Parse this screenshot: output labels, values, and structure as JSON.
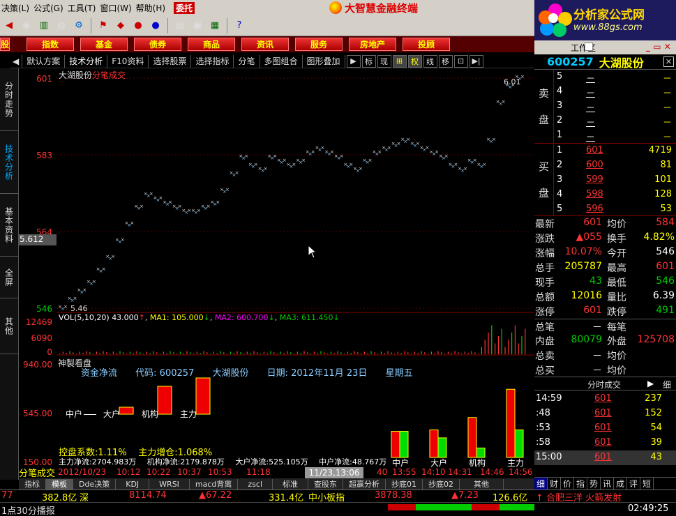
{
  "menu": {
    "items": [
      "决策(L)",
      "公式(G)",
      "工具(T)",
      "窗口(W)",
      "帮助(H)"
    ],
    "wt": "委托"
  },
  "brand": {
    "title": "大智慧金融终端",
    "ad_title": "分析家公式网",
    "ad_url": "www.88gs.com"
  },
  "nav": {
    "items": [
      "股",
      "指数",
      "基金",
      "债券",
      "商品",
      "资讯",
      "服务",
      "房地产",
      "投顾"
    ]
  },
  "funcbar": {
    "items": [
      "默认方案",
      "技术分析",
      "F10资料",
      "选择股票",
      "选择指标",
      "分笔",
      "多图组合",
      "图形叠加"
    ],
    "icons": [
      "标",
      "现",
      "⊞",
      "权",
      "线",
      "移"
    ]
  },
  "lefttabs": [
    "分时走势",
    "技术分析",
    "基本资料",
    "全屏",
    "其他"
  ],
  "chart": {
    "title": "大湖股份",
    "title_tag": "分笔成交",
    "ylabels": [
      "601",
      "583",
      "564",
      "546"
    ],
    "cursor_price": "5.612",
    "high_label": "6.01",
    "low_label": "5.46",
    "vol_legend": {
      "base": "VOL(5,10,20)",
      "v": "43.000",
      "ma1": "MA1: 105.000",
      "ma2": "MA2: 600.700",
      "ma3": "MA3: 611.450"
    },
    "vol_ylabels": [
      "12469",
      "6090",
      "0"
    ],
    "flow_ylabels": [
      "940.00",
      "545.00",
      "150.00"
    ]
  },
  "chart_data": {
    "type": "scatter",
    "title": "大湖股份 分笔成交",
    "x": [
      0,
      10,
      20,
      30,
      40,
      50,
      60,
      70,
      80,
      90,
      100,
      110,
      120,
      130,
      140,
      150,
      160,
      170,
      180,
      190,
      200,
      210,
      220,
      230,
      240,
      250,
      260,
      270,
      280,
      290,
      300,
      310,
      320,
      330,
      340,
      350,
      360,
      370,
      380,
      390,
      400,
      410,
      420,
      430,
      440,
      450,
      460,
      470,
      480,
      490,
      500,
      510,
      520,
      530,
      540,
      550,
      560,
      570,
      580,
      590,
      600,
      610,
      620,
      630,
      640,
      650,
      660,
      670,
      680
    ],
    "values": [
      5.46,
      5.48,
      5.5,
      5.52,
      5.55,
      5.58,
      5.62,
      5.66,
      5.7,
      5.73,
      5.72,
      5.71,
      5.7,
      5.69,
      5.69,
      5.7,
      5.71,
      5.74,
      5.78,
      5.82,
      5.8,
      5.79,
      5.82,
      5.81,
      5.8,
      5.81,
      5.83,
      5.84,
      5.83,
      5.82,
      5.8,
      5.79,
      5.81,
      5.83,
      5.84,
      5.85,
      5.86,
      5.85,
      5.84,
      5.83,
      5.82,
      5.8,
      5.79,
      5.81,
      5.8,
      5.86,
      5.95,
      5.99,
      6.01
    ],
    "ylim": [
      5.46,
      6.01
    ],
    "volume_ylim": [
      0,
      12469
    ]
  },
  "flow": {
    "head": "神製看盘",
    "label": "资金净流",
    "code": "代码: 600257",
    "name": "大湖股份",
    "date": "日期: 2012年11月 23日",
    "weekday": "星期五",
    "legend": [
      "中户",
      "大户",
      "机构",
      "主力"
    ],
    "kongpan": "控盘系数:1.11%",
    "zengcang": "主力增仓:1.068%",
    "vals": [
      "主力净流:2704.983万",
      "机构净流:2179.878万",
      "大户净流:525.105万",
      "中户净流:48.767万"
    ],
    "bars": [
      {
        "name": "中户",
        "a": 0.36,
        "b": 0.36
      },
      {
        "name": "大户",
        "a": 0.38,
        "b": 0.27
      },
      {
        "name": "机构",
        "a": 0.55,
        "b": 0.13
      },
      {
        "name": "主力",
        "a": 0.94,
        "b": 0.38
      }
    ]
  },
  "timeaxis": {
    "labels": [
      "2012/10/23",
      "10:12",
      "10:22",
      "10:37",
      "10:53",
      "11:18",
      "40",
      "13:55",
      "14:10",
      "14:31",
      "14:46",
      "14:56"
    ],
    "cursor": "11/23,13:06",
    "fbcs": "分笔成交"
  },
  "bottomtabs": [
    "指标",
    "模板",
    "Dde决策",
    "KDJ",
    "WRSI",
    "macd背离",
    "zscl",
    "标准",
    "查股东",
    "超赢分析",
    "抄底01",
    "抄底02",
    "其他"
  ],
  "status": {
    "a": "77",
    "b": "382.8亿",
    "c": "深",
    "d": "8114.74",
    "e": "▲67.22",
    "f": "331.4亿",
    "g": "中小板指",
    "h": "3878.38",
    "i": "▲7.23",
    "j": "126.6亿",
    "k": "↑ 合肥三洋 火箭发射",
    "l": "1点30分播报",
    "time": "02:49:25"
  },
  "rp": {
    "header": "工作区",
    "code": "600257",
    "name": "大湖股份",
    "sell_label": [
      "卖",
      "盘"
    ],
    "buy_label": [
      "买",
      "盘"
    ],
    "sells": [
      {
        "n": "5",
        "p": "－",
        "v": "－"
      },
      {
        "n": "4",
        "p": "－",
        "v": "－"
      },
      {
        "n": "3",
        "p": "－",
        "v": "－"
      },
      {
        "n": "2",
        "p": "－",
        "v": "－"
      },
      {
        "n": "1",
        "p": "－",
        "v": "－"
      }
    ],
    "buys": [
      {
        "n": "1",
        "p": "601",
        "v": "4719"
      },
      {
        "n": "2",
        "p": "600",
        "v": "81"
      },
      {
        "n": "3",
        "p": "599",
        "v": "101"
      },
      {
        "n": "4",
        "p": "598",
        "v": "128"
      },
      {
        "n": "5",
        "p": "596",
        "v": "53"
      }
    ],
    "quotes": [
      {
        "l": "最新",
        "v": "601",
        "l2": "均价",
        "v2": "584"
      },
      {
        "l": "涨跌",
        "v": "▲055",
        "l2": "换手",
        "v2": "4.82%"
      },
      {
        "l": "涨幅",
        "v": "10.07%",
        "l2": "今开",
        "v2": "546"
      },
      {
        "l": "总手",
        "v": "205787",
        "l2": "最高",
        "v2": "601"
      },
      {
        "l": "现手",
        "v": "43",
        "l2": "最低",
        "v2": "546"
      },
      {
        "l": "总额",
        "v": "12016",
        "l2": "量比",
        "v2": "6.39"
      },
      {
        "l": "涨停",
        "v": "601",
        "l2": "跌停",
        "v2": "491"
      },
      {
        "l": "总笔",
        "v": "－",
        "l2": "每笔",
        "v2": ""
      },
      {
        "l": "内盘",
        "v": "80079",
        "l2": "外盘",
        "v2": "125708"
      },
      {
        "l": "总卖",
        "v": "－",
        "l2": "均价",
        "v2": ""
      },
      {
        "l": "总买",
        "v": "－",
        "l2": "均价",
        "v2": ""
      }
    ],
    "ticks_head": "分时成交",
    "ticks_tab": "细",
    "ticks": [
      {
        "t": "14:59",
        "p": "601",
        "v": "237"
      },
      {
        "t": ":48",
        "p": "601",
        "v": "152"
      },
      {
        "t": ":53",
        "p": "601",
        "v": "54"
      },
      {
        "t": ":58",
        "p": "601",
        "v": "39"
      },
      {
        "t": "15:00",
        "p": "601",
        "v": "43"
      }
    ],
    "tabs": [
      "细",
      "财",
      "价",
      "指",
      "势",
      "讯",
      "成",
      "评",
      "短"
    ]
  }
}
